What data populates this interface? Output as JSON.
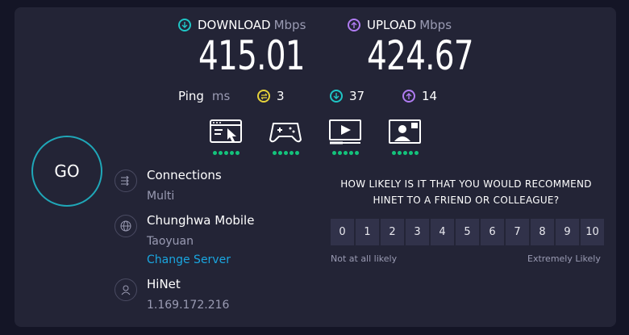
{
  "download": {
    "label": "DOWNLOAD",
    "unit": "Mbps",
    "value": "415.01",
    "color": "#1fc5c5"
  },
  "upload": {
    "label": "UPLOAD",
    "unit": "Mbps",
    "value": "424.67",
    "color": "#b07cf2"
  },
  "ping": {
    "label": "Ping",
    "unit": "ms",
    "idle": {
      "value": "3",
      "icon": "exchange-icon",
      "color": "#e6d23a"
    },
    "download": {
      "value": "37",
      "icon": "arrow-down-icon",
      "color": "#1fc5c5"
    },
    "upload": {
      "value": "14",
      "icon": "arrow-up-icon",
      "color": "#b07cf2"
    }
  },
  "use_cases": [
    {
      "icon": "web-browsing-icon",
      "rating": 5
    },
    {
      "icon": "gaming-icon",
      "rating": 5
    },
    {
      "icon": "video-streaming-icon",
      "rating": 5
    },
    {
      "icon": "video-call-icon",
      "rating": 5
    }
  ],
  "go_label": "GO",
  "connections": {
    "title": "Connections",
    "value": "Multi"
  },
  "server": {
    "name": "Chunghwa Mobile",
    "location": "Taoyuan",
    "change_label": "Change Server"
  },
  "isp": {
    "name": "HiNet",
    "ip": "1.169.172.216"
  },
  "survey": {
    "line1": "HOW LIKELY IS IT THAT YOU WOULD RECOMMEND",
    "line2": "HINET TO A FRIEND OR COLLEAGUE?",
    "options": [
      "0",
      "1",
      "2",
      "3",
      "4",
      "5",
      "6",
      "7",
      "8",
      "9",
      "10"
    ],
    "low_label": "Not at all likely",
    "high_label": "Extremely Likely"
  },
  "colors": {
    "accent_green": "#14c37c",
    "link": "#1aa6e0",
    "go_ring": "#1fa7b8"
  }
}
